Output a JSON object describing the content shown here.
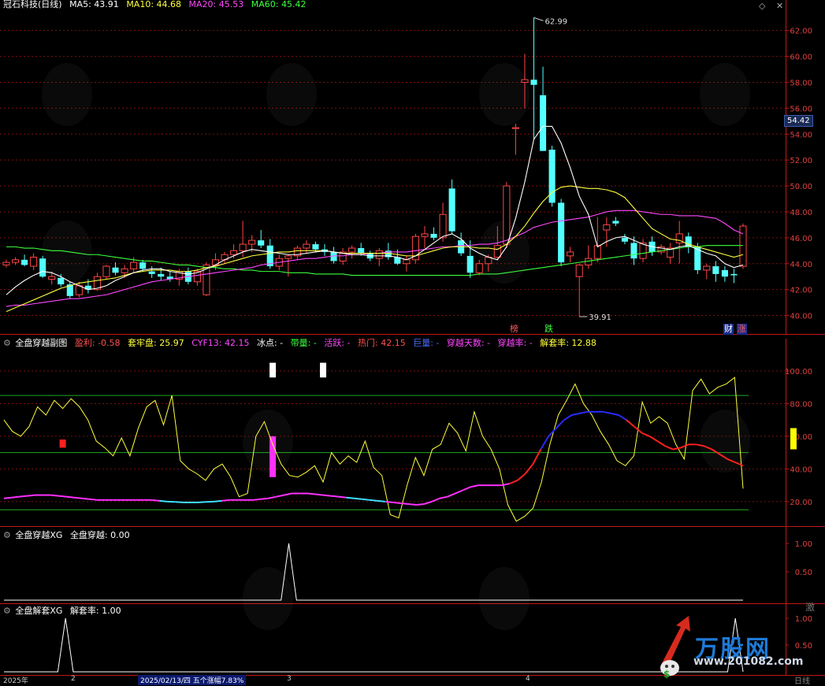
{
  "main_header": {
    "title": "冠石科技(日线)",
    "ma5": "MA5: 43.91",
    "ma10": "MA10: 44.68",
    "ma20": "MA20: 45.53",
    "ma60": "MA60: 45.42"
  },
  "sub1_header": {
    "title": "全盘穿越副图",
    "yingli": "盈利: -0.58",
    "taolao": "套牢盘: 25.97",
    "cyf13": "CYF13: 42.15",
    "bingdian": "冰点: -",
    "dailiang": "带量: -",
    "huoyue": "活跃: -",
    "remen": "热门: 42.15",
    "juliang": "巨量: -",
    "chuanyue_days": "穿越天数: -",
    "chuanyue_rate": "穿越率: -",
    "jietao": "解套率: 12.88"
  },
  "sub2_header": {
    "title": "全盘穿越XG",
    "value": "全盘穿越: 0.00"
  },
  "sub3_header": {
    "title": "全盘解套XG",
    "value": "解套率: 1.00"
  },
  "last_price": "54.42",
  "high_label": "62.99",
  "low_label": "39.91",
  "markers": {
    "bang": "榜",
    "die": "跌",
    "cai": "财",
    "zhang": "涨"
  },
  "bottom_bar": {
    "year": "2025年",
    "m1": "2",
    "date_info": "2025/02/13/四 五个涨幅7.83%",
    "m2": "3",
    "m3": "4",
    "tail": "日线"
  },
  "watermark": {
    "brand": "万股网",
    "url": "www.201082.com",
    "corner": "激"
  },
  "colors": {
    "up": "#ff4545",
    "down": "#54ffff",
    "ma5": "#ffffff",
    "ma10": "#ffff3c",
    "ma20": "#ff48ff",
    "ma60": "#3cff3c",
    "grid": "#7a1010",
    "axis": "#c01818"
  },
  "chart_data": [
    {
      "type": "candlestick",
      "title": "冠石科技(日线)",
      "ylim": [
        39,
        63.5
      ],
      "yticks": [
        40,
        42,
        44,
        46,
        48,
        50,
        52,
        54,
        56,
        58,
        60,
        62
      ],
      "candles": [
        [
          43.9,
          44.3,
          43.7,
          44.1
        ],
        [
          44.1,
          44.5,
          43.9,
          44.3
        ],
        [
          44.3,
          44.7,
          43.8,
          43.9
        ],
        [
          43.8,
          44.8,
          43.5,
          44.5
        ],
        [
          44.4,
          44.6,
          42.9,
          43.0
        ],
        [
          42.8,
          43.4,
          42.4,
          43.0
        ],
        [
          42.9,
          43.2,
          42.2,
          42.4
        ],
        [
          42.4,
          42.6,
          41.3,
          41.5
        ],
        [
          41.6,
          42.6,
          41.4,
          42.3
        ],
        [
          42.3,
          42.8,
          41.7,
          42.0
        ],
        [
          42.0,
          43.3,
          41.9,
          43.0
        ],
        [
          43.0,
          43.9,
          42.8,
          43.8
        ],
        [
          43.7,
          44.1,
          43.1,
          43.3
        ],
        [
          43.3,
          43.9,
          42.9,
          43.6
        ],
        [
          43.6,
          44.5,
          43.3,
          44.1
        ],
        [
          44.1,
          44.3,
          43.4,
          43.6
        ],
        [
          43.4,
          43.8,
          42.9,
          43.2
        ],
        [
          43.2,
          43.7,
          42.7,
          43.0
        ],
        [
          43.0,
          43.4,
          42.6,
          42.8
        ],
        [
          42.8,
          43.6,
          42.3,
          43.4
        ],
        [
          43.4,
          43.7,
          42.4,
          42.6
        ],
        [
          42.6,
          43.6,
          42.3,
          43.4
        ],
        [
          41.6,
          44.1,
          41.5,
          43.9
        ],
        [
          43.9,
          44.8,
          43.5,
          44.3
        ],
        [
          44.3,
          44.9,
          44.0,
          44.7
        ],
        [
          44.7,
          45.5,
          44.4,
          45.0
        ],
        [
          45.0,
          47.3,
          44.5,
          45.5
        ],
        [
          45.5,
          46.2,
          44.9,
          45.8
        ],
        [
          45.8,
          46.6,
          45.2,
          45.4
        ],
        [
          45.4,
          45.9,
          43.6,
          43.8
        ],
        [
          43.8,
          44.7,
          43.5,
          44.4
        ],
        [
          44.4,
          44.7,
          43.0,
          44.6
        ],
        [
          44.6,
          45.4,
          44.3,
          45.2
        ],
        [
          45.2,
          45.8,
          44.8,
          45.5
        ],
        [
          45.5,
          45.7,
          44.9,
          45.1
        ],
        [
          45.1,
          45.5,
          44.6,
          44.9
        ],
        [
          44.9,
          45.3,
          44.0,
          44.2
        ],
        [
          44.2,
          45.2,
          43.9,
          44.9
        ],
        [
          44.9,
          45.4,
          44.4,
          45.2
        ],
        [
          45.2,
          45.6,
          44.6,
          44.8
        ],
        [
          44.8,
          45.0,
          44.2,
          44.4
        ],
        [
          44.4,
          45.2,
          43.8,
          45.0
        ],
        [
          45.0,
          45.6,
          44.3,
          44.5
        ],
        [
          44.5,
          45.1,
          43.9,
          44.0
        ],
        [
          44.0,
          44.6,
          43.4,
          44.3
        ],
        [
          44.3,
          46.3,
          44.0,
          46.1
        ],
        [
          46.1,
          46.9,
          45.2,
          46.3
        ],
        [
          46.3,
          46.8,
          45.8,
          46.0
        ],
        [
          46.0,
          48.7,
          45.7,
          47.8
        ],
        [
          49.8,
          50.5,
          46.3,
          46.5
        ],
        [
          45.8,
          46.4,
          44.6,
          44.8
        ],
        [
          44.6,
          45.8,
          42.9,
          43.3
        ],
        [
          43.3,
          44.3,
          43.1,
          44.0
        ],
        [
          44.0,
          44.7,
          43.4,
          44.5
        ],
        [
          44.5,
          46.9,
          44.3,
          45.4
        ],
        [
          45.5,
          50.3,
          45.2,
          50.0
        ],
        [
          54.5,
          54.8,
          52.4,
          54.5
        ],
        [
          58.0,
          60.2,
          56.0,
          58.2
        ],
        [
          58.2,
          62.99,
          53.6,
          57.8
        ],
        [
          57.0,
          59.2,
          52.7,
          52.7
        ],
        [
          52.8,
          53.1,
          48.4,
          48.7
        ],
        [
          48.7,
          49.0,
          43.8,
          44.1
        ],
        [
          44.6,
          45.3,
          44.1,
          44.9
        ],
        [
          43.0,
          44.0,
          39.91,
          43.9
        ],
        [
          43.9,
          45.4,
          43.6,
          44.4
        ],
        [
          44.4,
          47.6,
          44.1,
          45.4
        ],
        [
          46.6,
          47.6,
          45.3,
          47.0
        ],
        [
          47.3,
          47.6,
          46.9,
          47.1
        ],
        [
          46.0,
          46.3,
          45.5,
          45.7
        ],
        [
          45.6,
          46.1,
          43.9,
          44.4
        ],
        [
          44.4,
          45.9,
          44.1,
          45.6
        ],
        [
          45.7,
          46.1,
          44.6,
          44.9
        ],
        [
          44.9,
          45.5,
          44.7,
          45.3
        ],
        [
          44.5,
          45.6,
          44.0,
          45.2
        ],
        [
          45.6,
          47.3,
          44.0,
          46.3
        ],
        [
          46.1,
          46.4,
          44.8,
          45.3
        ],
        [
          45.3,
          45.6,
          43.2,
          43.5
        ],
        [
          43.5,
          44.0,
          42.8,
          43.8
        ],
        [
          43.8,
          44.2,
          42.6,
          43.2
        ],
        [
          43.5,
          43.8,
          42.6,
          43.0
        ],
        [
          43.2,
          43.6,
          42.5,
          43.1
        ],
        [
          43.8,
          47.1,
          43.6,
          46.9
        ]
      ],
      "ma5": [
        41.6,
        42.2,
        42.7,
        43.1,
        43.4,
        43.3,
        43.0,
        42.6,
        42.3,
        42.0,
        42.1,
        42.3,
        42.7,
        43.0,
        43.3,
        43.5,
        43.6,
        43.6,
        43.4,
        43.3,
        43.2,
        43.3,
        43.6,
        43.9,
        44.3,
        44.6,
        44.9,
        45.1,
        45.0,
        44.9,
        44.8,
        44.7,
        44.7,
        44.8,
        44.9,
        45.0,
        44.9,
        44.8,
        44.7,
        44.7,
        44.6,
        44.6,
        44.6,
        44.5,
        44.3,
        44.6,
        45.1,
        45.6,
        46.1,
        46.3,
        45.9,
        45.2,
        44.8,
        44.5,
        44.3,
        45.3,
        47.5,
        50.3,
        53.6,
        54.6,
        54.6,
        53.3,
        51.4,
        49.2,
        47.8,
        45.3,
        45.7,
        46.0,
        46.1,
        45.8,
        45.5,
        45.3,
        45.2,
        45.1,
        45.3,
        45.4,
        45.1,
        44.8,
        44.6,
        44.0,
        43.7,
        43.9
      ],
      "ma10": [
        40.3,
        40.6,
        40.9,
        41.2,
        41.5,
        41.8,
        42.1,
        42.3,
        42.5,
        42.6,
        42.7,
        42.8,
        42.9,
        43.1,
        43.3,
        43.4,
        43.5,
        43.5,
        43.5,
        43.4,
        43.4,
        43.5,
        43.7,
        43.8,
        44.0,
        44.2,
        44.4,
        44.6,
        44.7,
        44.8,
        44.9,
        44.9,
        45.0,
        45.0,
        45.0,
        45.0,
        44.9,
        44.8,
        44.8,
        44.8,
        44.8,
        44.8,
        44.8,
        44.7,
        44.6,
        44.6,
        44.8,
        45.0,
        45.2,
        45.3,
        45.3,
        45.3,
        45.2,
        45.2,
        45.1,
        45.5,
        46.1,
        46.9,
        47.9,
        48.8,
        49.5,
        49.9,
        50.0,
        49.9,
        49.8,
        49.8,
        49.7,
        49.5,
        49.1,
        48.3,
        47.5,
        46.7,
        46.3,
        45.9,
        45.8,
        45.5,
        45.3,
        45.1,
        44.9,
        44.7,
        44.5,
        44.7
      ],
      "ma20": [
        40.7,
        40.8,
        40.8,
        40.9,
        41.0,
        41.1,
        41.2,
        41.3,
        41.3,
        41.4,
        41.5,
        41.6,
        41.8,
        42.0,
        42.2,
        42.4,
        42.6,
        42.7,
        42.8,
        42.9,
        43.0,
        43.1,
        43.2,
        43.3,
        43.4,
        43.5,
        43.6,
        43.7,
        43.9,
        44.0,
        44.1,
        44.2,
        44.3,
        44.4,
        44.4,
        44.5,
        44.6,
        44.6,
        44.7,
        44.7,
        44.8,
        44.8,
        44.9,
        44.9,
        44.9,
        45.0,
        45.1,
        45.2,
        45.3,
        45.3,
        45.4,
        45.4,
        45.5,
        45.5,
        45.6,
        45.8,
        46.1,
        46.4,
        46.8,
        47.0,
        47.2,
        47.3,
        47.4,
        47.5,
        47.6,
        47.8,
        48.0,
        48.1,
        48.1,
        48.1,
        48.0,
        47.9,
        47.8,
        47.8,
        47.7,
        47.7,
        47.7,
        47.6,
        47.5,
        47.1,
        46.6,
        46.3
      ],
      "ma60": [
        45.3,
        45.3,
        45.2,
        45.2,
        45.1,
        45.0,
        45.0,
        44.9,
        44.8,
        44.7,
        44.7,
        44.6,
        44.5,
        44.4,
        44.3,
        44.2,
        44.2,
        44.1,
        44.0,
        43.9,
        43.9,
        43.8,
        43.7,
        43.7,
        43.6,
        43.6,
        43.5,
        43.5,
        43.4,
        43.4,
        43.4,
        43.3,
        43.3,
        43.3,
        43.2,
        43.2,
        43.2,
        43.2,
        43.1,
        43.1,
        43.1,
        43.1,
        43.1,
        43.1,
        43.1,
        43.1,
        43.1,
        43.1,
        43.1,
        43.1,
        43.1,
        43.1,
        43.2,
        43.2,
        43.2,
        43.3,
        43.4,
        43.5,
        43.6,
        43.7,
        43.8,
        43.9,
        44.0,
        44.1,
        44.2,
        44.3,
        44.4,
        44.5,
        44.6,
        44.7,
        44.8,
        44.9,
        45.0,
        45.1,
        45.2,
        45.3,
        45.3,
        45.4,
        45.4,
        45.4,
        45.4,
        45.4
      ]
    },
    {
      "type": "line",
      "title": "全盘穿越副图",
      "ylim": [
        5,
        113
      ],
      "yticks": [
        20,
        40,
        60,
        80,
        100
      ],
      "hlines": [
        85,
        50,
        15
      ],
      "yellow": [
        70,
        63,
        60,
        66,
        78,
        73,
        82,
        77,
        83,
        78,
        70,
        57,
        53,
        48,
        59,
        48,
        65,
        78,
        82,
        67,
        85,
        45,
        40,
        37,
        33,
        40,
        43,
        35,
        23,
        25,
        60,
        69,
        55,
        43,
        36,
        35,
        38,
        42,
        32,
        50,
        43,
        48,
        44,
        57,
        41,
        36,
        12,
        10,
        30,
        47,
        36,
        52,
        55,
        68,
        62,
        51,
        75,
        60,
        52,
        40,
        18,
        8,
        11,
        16,
        32,
        55,
        73,
        82,
        92,
        80,
        73,
        63,
        55,
        45,
        42,
        48,
        81,
        68,
        72,
        68,
        55,
        46,
        88,
        95,
        86,
        90,
        92,
        96,
        28
      ],
      "cyf13": [
        22,
        22.5,
        23,
        23.5,
        24,
        24,
        24,
        23.5,
        23,
        22.5,
        22,
        21.5,
        21,
        21,
        21,
        21,
        21,
        21,
        21,
        21,
        20.5,
        20,
        19.8,
        19.5,
        19.5,
        19.5,
        19.8,
        20,
        20.5,
        21,
        21,
        21,
        21,
        21.5,
        22,
        23,
        24,
        25,
        25,
        25,
        24.5,
        24,
        23.5,
        23,
        22.5,
        22,
        21.5,
        21,
        20.5,
        20,
        19.5,
        19,
        18.5,
        18,
        18.5,
        20,
        22,
        23,
        25,
        27,
        29,
        30,
        30,
        30,
        30,
        31,
        33,
        37,
        43,
        52,
        60,
        65,
        70,
        73,
        74,
        75,
        75,
        75,
        74,
        73,
        70,
        66,
        62,
        60,
        57,
        54,
        52,
        53,
        55,
        55,
        54,
        52,
        49,
        46,
        44,
        42
      ],
      "base": 50,
      "red_fill": [
        [
          20,
          27,
          54.5
        ],
        [
          32,
          40,
          53.5
        ],
        [
          41,
          43,
          51.5
        ],
        [
          46,
          52,
          56
        ],
        [
          60,
          72,
          67
        ]
      ],
      "cyan_fill": [
        [
          0,
          18,
          43
        ],
        [
          21,
          26,
          45
        ],
        [
          33,
          42,
          47
        ],
        [
          43,
          46,
          47
        ],
        [
          52,
          59,
          47
        ],
        [
          73,
          82,
          43
        ],
        [
          82,
          95,
          42
        ]
      ],
      "sticks": [
        [
          7,
          53,
          58,
          "#ff2020"
        ],
        [
          32,
          35,
          60,
          "#ff30ff"
        ],
        [
          32,
          96,
          105,
          "#ffffff"
        ],
        [
          38,
          96,
          105,
          "#ffffff"
        ],
        [
          94,
          52,
          65,
          "#ffff00"
        ]
      ]
    },
    {
      "type": "line",
      "title": "全盘穿越XG",
      "ylim": [
        0,
        1.25
      ],
      "yticks": [
        0.5,
        1.0
      ],
      "spikes": [
        {
          "at": 37,
          "value": 1.0
        }
      ]
    },
    {
      "type": "line",
      "title": "全盘解套XG",
      "ylim": [
        0,
        1.25
      ],
      "yticks": [
        0.5,
        1.0
      ],
      "spikes": [
        {
          "at": 8,
          "value": 1.0
        },
        {
          "at": 95,
          "value": 1.0
        }
      ]
    }
  ]
}
